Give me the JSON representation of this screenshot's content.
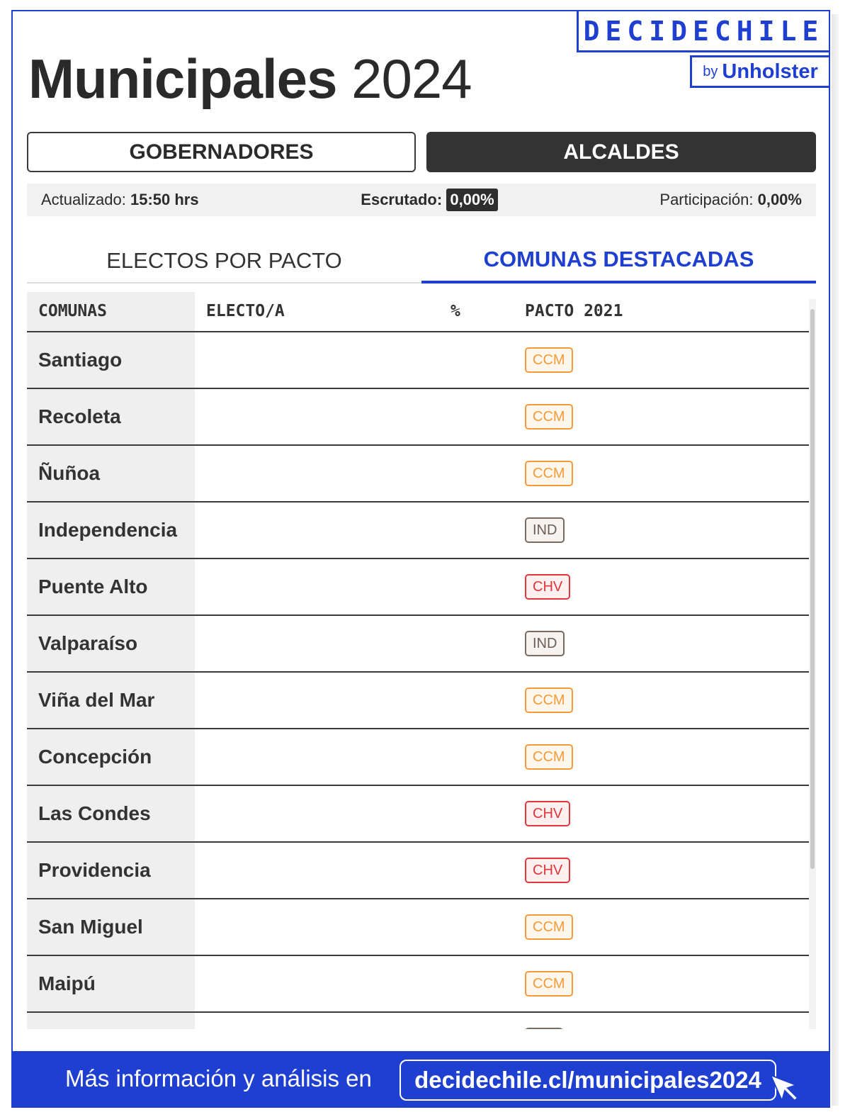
{
  "header": {
    "title_main": "Municipales",
    "title_year": "2024",
    "brand": "DECIDECHILE",
    "brand_by": "by",
    "brand_company": "Unholster"
  },
  "election_toggle": {
    "options": [
      "GOBERNADORES",
      "ALCALDES"
    ],
    "selected": "ALCALDES"
  },
  "status": {
    "updated_label": "Actualizado:",
    "updated_value": "15:50 hrs",
    "counted_label": "Escrutado:",
    "counted_value": "0,00%",
    "turnout_label": "Participación:",
    "turnout_value": "0,00%"
  },
  "tabs": [
    {
      "label": "ELECTOS POR PACTO",
      "active": false
    },
    {
      "label": "COMUNAS DESTACADAS",
      "active": true
    }
  ],
  "table": {
    "headers": [
      "COMUNAS",
      "ELECTO/A",
      "%",
      "PACTO 2021"
    ],
    "rows": [
      {
        "comuna": "Santiago",
        "electo": "",
        "pct": "",
        "pacto": "CCM"
      },
      {
        "comuna": "Recoleta",
        "electo": "",
        "pct": "",
        "pacto": "CCM"
      },
      {
        "comuna": "Ñuñoa",
        "electo": "",
        "pct": "",
        "pacto": "CCM"
      },
      {
        "comuna": "Independencia",
        "electo": "",
        "pct": "",
        "pacto": "IND"
      },
      {
        "comuna": "Puente Alto",
        "electo": "",
        "pct": "",
        "pacto": "CHV"
      },
      {
        "comuna": "Valparaíso",
        "electo": "",
        "pct": "",
        "pacto": "IND"
      },
      {
        "comuna": "Viña del Mar",
        "electo": "",
        "pct": "",
        "pacto": "CCM"
      },
      {
        "comuna": "Concepción",
        "electo": "",
        "pct": "",
        "pacto": "CCM"
      },
      {
        "comuna": "Las Condes",
        "electo": "",
        "pct": "",
        "pacto": "CHV"
      },
      {
        "comuna": "Providencia",
        "electo": "",
        "pct": "",
        "pacto": "CHV"
      },
      {
        "comuna": "San Miguel",
        "electo": "",
        "pct": "",
        "pacto": "CCM"
      },
      {
        "comuna": "Maipú",
        "electo": "",
        "pct": "",
        "pacto": "CCM"
      }
    ]
  },
  "pact_colors": {
    "CCM": "#f29b3c",
    "IND": "#7a6b60",
    "CHV": "#e3353c"
  },
  "footer": {
    "lead": "Más información y análisis en",
    "link": "decidechile.cl/municipales2024"
  },
  "accent_color": "#1f3fd1"
}
